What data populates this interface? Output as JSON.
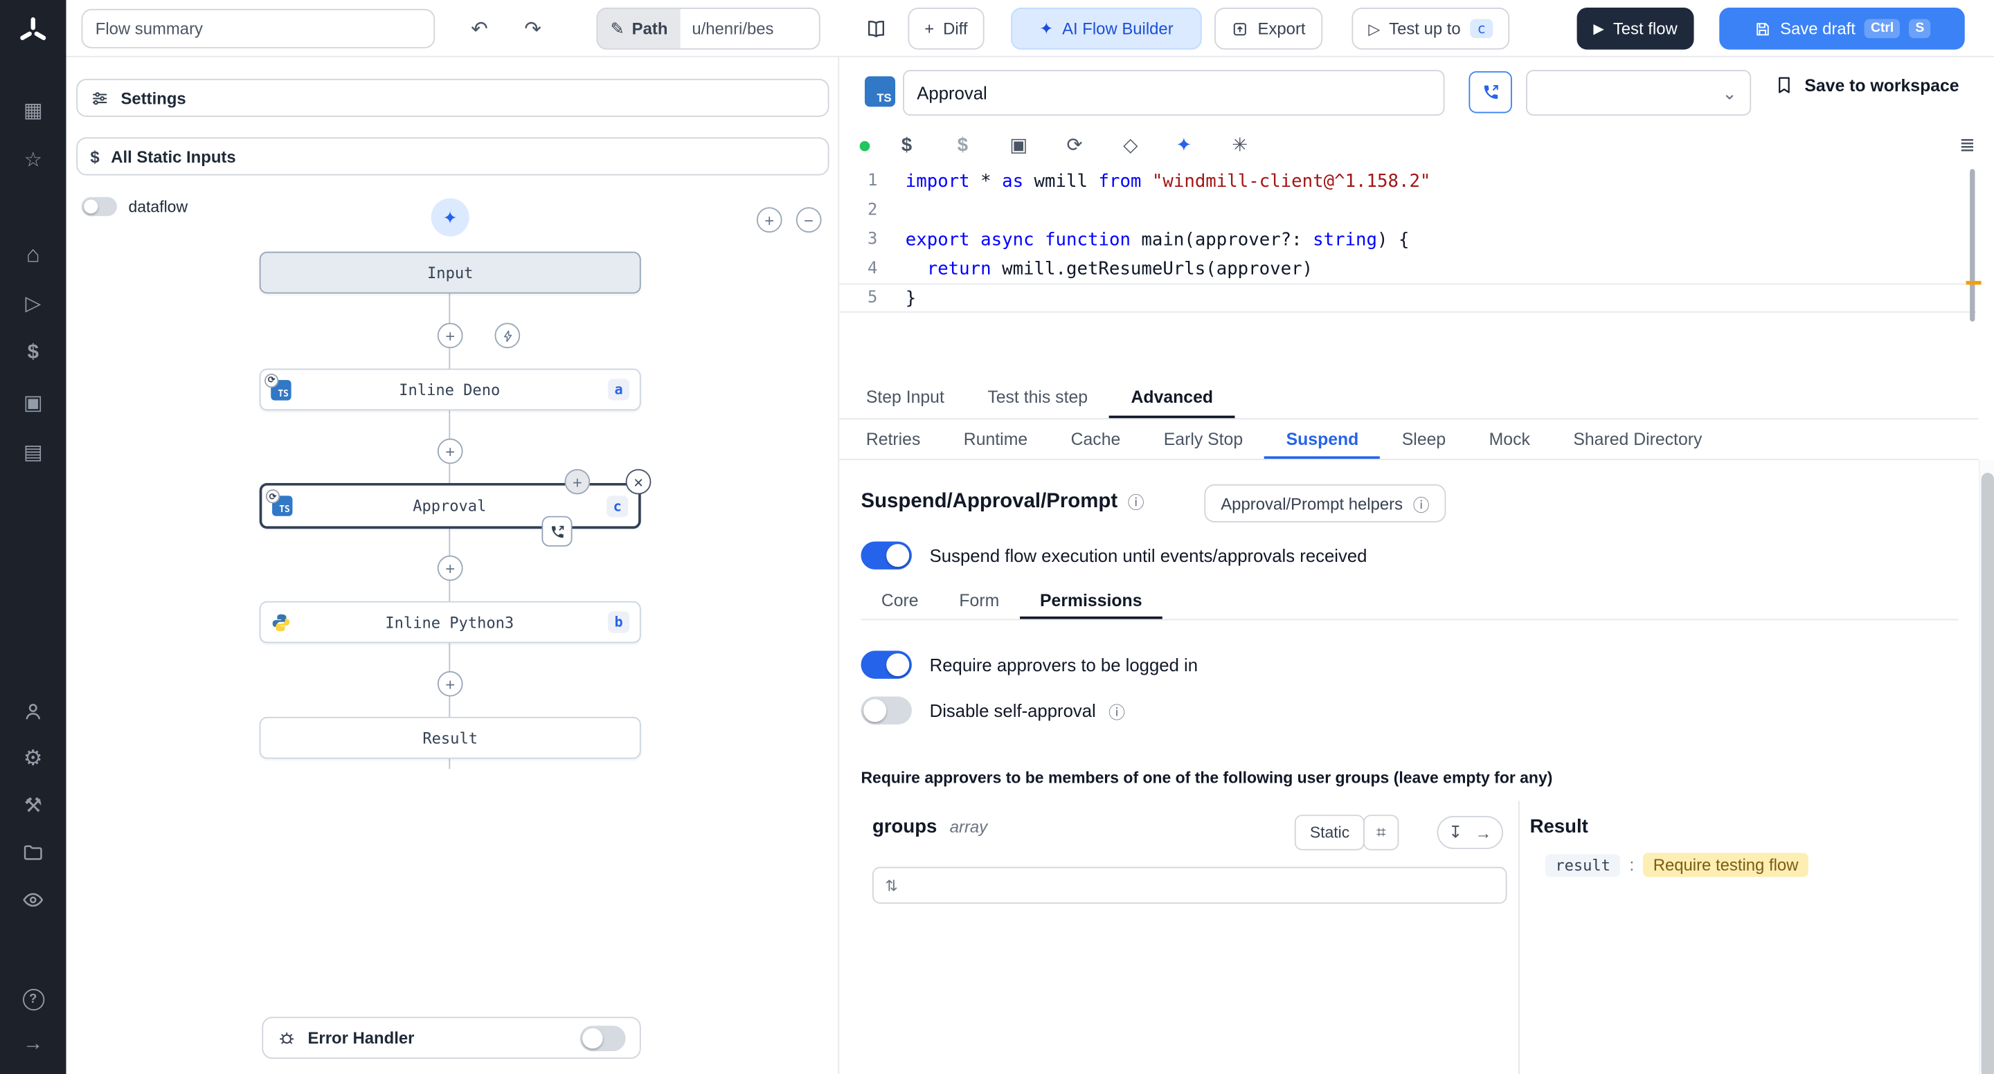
{
  "icons": {
    "undo": "↶",
    "redo": "↷",
    "pencil": "✎",
    "plus": "+",
    "minus": "−",
    "sparkle": "✦",
    "play": "▷",
    "play_solid": "▶",
    "dollar": "$",
    "board": "▦",
    "star": "☆",
    "home": "⌂",
    "gear": "⚙",
    "tools": "⚒",
    "help": "?",
    "arrow_right": "→",
    "refresh": "⟳",
    "package": "▣",
    "diamond": "◇",
    "asterisk": "✳",
    "library": "≣",
    "loop": "⟳",
    "swap": "⇅",
    "insert": "↧",
    "grid": "⌗",
    "info": "ⓘ",
    "close": "×",
    "dot": "●",
    "chevron_down": "⌄",
    "calendar": "▤"
  },
  "colors": {
    "accent": "#2563eb",
    "ai_button_bg": "#dbeafe",
    "test_flow_bg": "#1e293b",
    "save_draft_bg": "#3b82f6",
    "ts_blue": "#3178c6",
    "result_badge_bg": "#fdeeb4",
    "keyword": "#0000ff",
    "string": "#a31515"
  },
  "sidebar_icon_names": [
    "windmill-logo",
    "boards",
    "favorites",
    "home",
    "runs",
    "variables",
    "resources",
    "schedules",
    "users",
    "settings",
    "workers",
    "folders",
    "audit-logs",
    "help",
    "expand"
  ],
  "toolbar": {
    "flow_summary": "Flow summary",
    "path_label": "Path",
    "path_value": "u/henri/bes",
    "diff_label": "Diff",
    "ai_label": "AI Flow Builder",
    "export_label": "Export",
    "test_up_to_label": "Test up to",
    "test_up_to_badge": "c",
    "test_flow_label": "Test flow",
    "save_draft_label": "Save draft",
    "kbd_ctrl": "Ctrl",
    "kbd_s": "S"
  },
  "flow": {
    "settings_label": "Settings",
    "static_inputs_label": "All Static Inputs",
    "dataflow_label": "dataflow",
    "nodes": {
      "input": "Input",
      "deno_label": "Inline Deno",
      "deno_badge": "a",
      "approval_label": "Approval",
      "approval_badge": "c",
      "python_label": "Inline Python3",
      "python_badge": "b",
      "result": "Result"
    },
    "error_handler_label": "Error Handler"
  },
  "editor": {
    "step_name": "Approval",
    "save_to_workspace": "Save to workspace",
    "line_numbers": [
      "1",
      "2",
      "3",
      "4",
      "5"
    ],
    "code": {
      "l1": {
        "t0": "import",
        "t1": " * ",
        "t2": "as",
        "t3": " wmill ",
        "t4": "from",
        "t5": " ",
        "t6": "\"windmill-client@^1.158.2\""
      },
      "l3": {
        "t0": "export",
        "t1": " ",
        "t2": "async",
        "t3": " ",
        "t4": "function",
        "t5": " main(approver?: ",
        "t6": "string",
        "t7": ") {"
      },
      "l4": {
        "t0": "  ",
        "t1": "return",
        "t2": " wmill.getResumeUrls(approver)"
      },
      "l5": {
        "t0": "}"
      }
    }
  },
  "tabs": {
    "main": [
      "Step Input",
      "Test this step",
      "Advanced"
    ],
    "advanced": [
      "Retries",
      "Runtime",
      "Cache",
      "Early Stop",
      "Suspend",
      "Sleep",
      "Mock",
      "Shared Directory"
    ]
  },
  "suspend": {
    "title": "Suspend/Approval/Prompt",
    "helpers_label": "Approval/Prompt helpers",
    "toggle_label": "Suspend flow execution until events/approvals received",
    "perm_tabs": [
      "Core",
      "Form",
      "Permissions"
    ],
    "require_login_label": "Require approvers to be logged in",
    "disable_self_label": "Disable self-approval",
    "hint": "Require approvers to be members of one of the following user groups (leave empty for any)",
    "groups_label": "groups",
    "groups_type": "array",
    "static_label": "Static",
    "result_title": "Result",
    "result_key": "result",
    "result_colon": ":",
    "result_value": "Require testing flow"
  }
}
